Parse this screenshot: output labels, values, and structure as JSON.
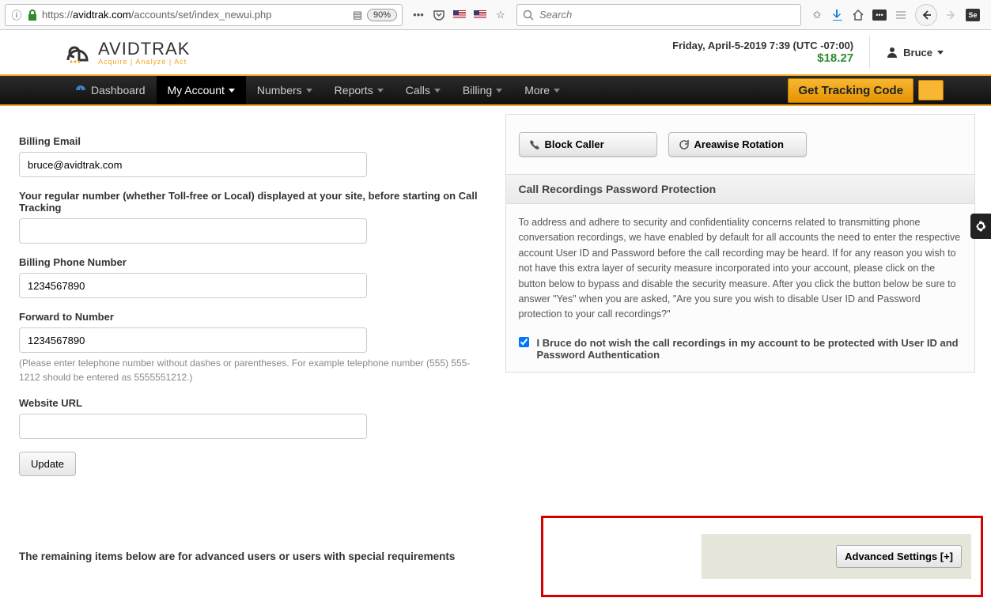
{
  "browser": {
    "url_prefix": "https://",
    "url_domain": "avidtrak.com",
    "url_path": "/accounts/set/index_newui.php",
    "zoom": "90%",
    "search_placeholder": "Search"
  },
  "header": {
    "date_text": "Friday, April-5-2019 7:39 (UTC -07:00)",
    "balance": "$18.27",
    "user_name": "Bruce",
    "logo_brand": "AVIDTRAK",
    "logo_tag": "Acquire | Analyze | Act"
  },
  "nav": {
    "dashboard": "Dashboard",
    "my_account": "My Account",
    "numbers": "Numbers",
    "reports": "Reports",
    "calls": "Calls",
    "billing": "Billing",
    "more": "More",
    "tracking_btn": "Get Tracking Code"
  },
  "form": {
    "billing_email_label": "Billing Email",
    "billing_email_value": "bruce@avidtrak.com",
    "regular_number_label": "Your regular number (whether Toll-free or Local) displayed at your site, before starting on Call Tracking",
    "regular_number_value": "",
    "billing_phone_label": "Billing Phone Number",
    "billing_phone_value": "1234567890",
    "forward_label": "Forward to Number",
    "forward_value": "1234567890",
    "forward_hint": "(Please enter telephone number without dashes or parentheses. For example telephone number (555) 555-1212 should be entered as 5555551212.)",
    "website_label": "Website URL",
    "website_value": "",
    "update_btn": "Update"
  },
  "right": {
    "block_caller": "Block Caller",
    "areawise": "Areawise Rotation",
    "panel_title": "Call Recordings Password Protection",
    "panel_text": "To address and adhere to security and confidentiality concerns related to transmitting phone conversation recordings, we have enabled by default for all accounts the need to enter the respective account User ID and Password before the call recording may be heard. If for any reason you wish to not have this extra layer of security measure incorporated into your account, please click on the button below to bypass and disable the security measure. After you click the button below be sure to answer \"Yes\" when you are asked, \"Are you sure you wish to disable User ID and Password protection to your call recordings?\"",
    "checkbox_label": "I Bruce do not wish the call recordings in my account to be protected with User ID and Password Authentication"
  },
  "bottom": {
    "note": "The remaining items below are for advanced users or users with special requirements",
    "adv_btn": "Advanced Settings [+]"
  }
}
